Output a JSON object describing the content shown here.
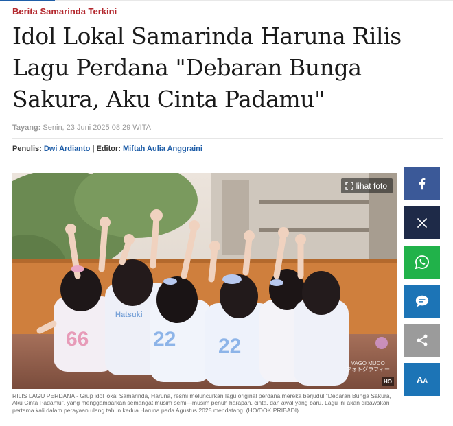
{
  "article": {
    "kicker": "Berita Samarinda Terkini",
    "headline": "Idol Lokal Samarinda Haruna Rilis Lagu Perdana \"Debaran Bunga Sakura, Aku Cinta Padamu\"",
    "publish_label": "Tayang:",
    "publish_time": "Senin, 23 Juni 2025 08:29 WITA",
    "writer_label": "Penulis:",
    "writer_name": "Dwi Ardianto",
    "separator": "|",
    "editor_label": "Editor:",
    "editor_name": "Miftah Aulia Anggraini"
  },
  "photo": {
    "view_label": "lihat foto",
    "badge": "HO",
    "watermark_line1": "VAGO MUDO",
    "watermark_line2": "フォトグラフィー",
    "caption": "RILIS LAGU PERDANA - Grup idol lokal Samarinda, Haruna, resmi meluncurkan lagu original perdana mereka berjudul \"Debaran Bunga Sakura, Aku Cinta Padamu\", yang menggambarkan semangat musim semi—musim penuh harapan, cinta, dan awal yang baru. Lagu ini akan dibawakan pertama kali dalam perayaan ulang tahun kedua Haruna pada Agustus 2025 mendatang. (HO/DOK PRIBADI)"
  },
  "share": {
    "font_size_label": "A",
    "font_size_sub": "A",
    "icons": [
      "facebook-icon",
      "x-icon",
      "whatsapp-icon",
      "comment-icon",
      "share-icon",
      "font-size-icon"
    ],
    "colors": {
      "facebook": "#3b5998",
      "x": "#1e2a48",
      "whatsapp": "#21b24a",
      "comment": "#1c74b6",
      "share": "#9b9b9b",
      "font_size": "#1c74b6"
    }
  },
  "colors": {
    "kicker": "#b3272d",
    "link": "#1f5ea8"
  }
}
